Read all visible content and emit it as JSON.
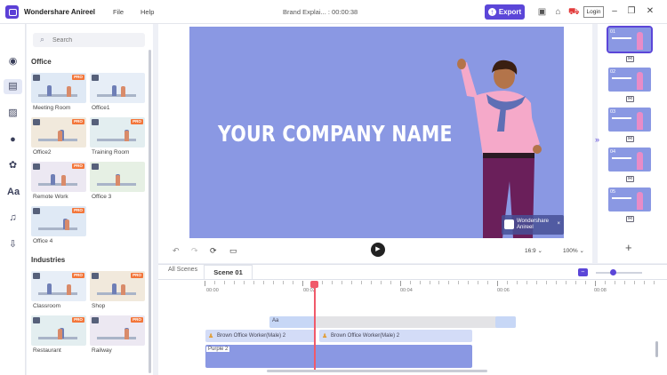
{
  "app": {
    "name": "Wondershare Anireel",
    "menu": [
      "File",
      "Help"
    ],
    "document_title": "Brand Explai... : 00:00:38",
    "export_label": "Export",
    "login_label": "Login"
  },
  "colors": {
    "accent": "#5b46d8",
    "canvas_bg": "#8a98e3",
    "pro_badge": "#f3763a",
    "playhead": "#f05a6a"
  },
  "rail": {
    "icons": [
      "palette-icon",
      "scene-template-icon",
      "background-icon",
      "character-icon",
      "props-icon",
      "text-icon",
      "music-icon",
      "import-icon"
    ],
    "active_index": 1
  },
  "panel": {
    "search_placeholder": "Search",
    "sections": [
      {
        "title": "Office",
        "items": [
          {
            "label": "Meeting Room",
            "pro": true
          },
          {
            "label": "Office1",
            "pro": false
          },
          {
            "label": "Office2",
            "pro": true
          },
          {
            "label": "Training Room",
            "pro": true
          },
          {
            "label": "Remote Work",
            "pro": true
          },
          {
            "label": "Office 3",
            "pro": false
          },
          {
            "label": "Office 4",
            "pro": true
          }
        ]
      },
      {
        "title": "Industries",
        "items": [
          {
            "label": "Classroom",
            "pro": true
          },
          {
            "label": "Shop",
            "pro": true
          },
          {
            "label": "Restaurant",
            "pro": true
          },
          {
            "label": "Railway",
            "pro": true
          }
        ]
      }
    ],
    "pro_label": "PRO"
  },
  "canvas": {
    "headline": "YOUR COMPANY NAME",
    "watermark_line1": "Wondershare",
    "watermark_line2": "Anireel",
    "watermark_close": "×"
  },
  "controls": {
    "aspect_ratio": "16:9",
    "zoom": "100%"
  },
  "scenes": [
    "01",
    "02",
    "03",
    "04",
    "05"
  ],
  "timeline": {
    "tabs": [
      "All Scenes",
      "Scene 01"
    ],
    "active_tab": "Scene 01",
    "ruler_labels": [
      "00:00",
      "00:02",
      "00:04",
      "00:06",
      "00:08"
    ],
    "tracks": [
      {
        "label": "",
        "kind": "text"
      },
      {
        "label": "Brown Office Worker(Male) 2",
        "kind": "character"
      },
      {
        "label": "Brown Office Worker(Male) 2",
        "kind": "character"
      },
      {
        "label": "Purple 2",
        "kind": "background"
      }
    ]
  }
}
